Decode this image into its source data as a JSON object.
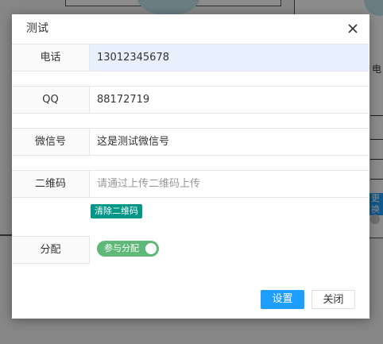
{
  "dialog": {
    "title": "测试",
    "fields": [
      {
        "label": "电话",
        "value": "13012345678",
        "placeholder": ""
      },
      {
        "label": "QQ",
        "value": "88172719",
        "placeholder": ""
      },
      {
        "label": "微信号",
        "value": "这是测试微信号",
        "placeholder": ""
      },
      {
        "label": "二维码",
        "value": "",
        "placeholder": "请通过上传二维码上传"
      }
    ],
    "clear_qr_label": "清除二维码",
    "assign": {
      "label": "分配",
      "toggle_text": "参与分配",
      "checked": true
    },
    "buttons": {
      "confirm": "设置",
      "close": "关闭"
    }
  },
  "background": {
    "right_text_1": "电",
    "right_text_2": "更",
    "blue_label": "更换"
  },
  "colors": {
    "primary": "#1e9fff",
    "teal": "#009688",
    "toggle_on": "#5fb878",
    "autofill": "#e8f0fe"
  }
}
